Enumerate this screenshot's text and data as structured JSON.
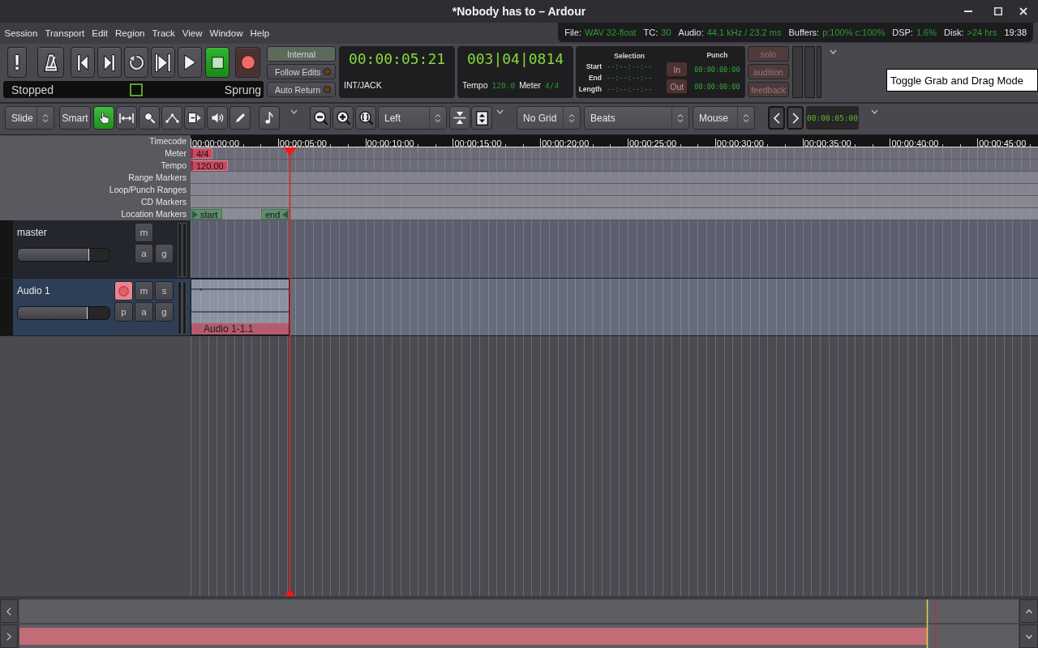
{
  "window": {
    "title": "*Nobody has to – Ardour"
  },
  "menu": [
    "Session",
    "Transport",
    "Edit",
    "Region",
    "Track",
    "View",
    "Window",
    "Help"
  ],
  "status_bar": {
    "items": [
      {
        "label": "File:",
        "value": "WAV 32-float"
      },
      {
        "label": "TC:",
        "value": "30"
      },
      {
        "label": "Audio:",
        "value": "44.1 kHz / 23.2 ms"
      },
      {
        "label": "Buffers:",
        "value": "p:100% c:100%"
      },
      {
        "label": "DSP:",
        "value": "1.6%"
      },
      {
        "label": "Disk:",
        "value": ">24 hrs"
      }
    ],
    "time": "19:38"
  },
  "transport": {
    "buttons": [
      {
        "kind": "error-log",
        "label": "!",
        "on": false
      },
      {
        "kind": "metronome",
        "on": false
      },
      {
        "kind": "to-start",
        "on": false
      },
      {
        "kind": "to-end",
        "on": false
      },
      {
        "kind": "loop",
        "on": false
      },
      {
        "kind": "play-range",
        "on": false
      },
      {
        "kind": "play",
        "on": false
      },
      {
        "kind": "stop",
        "on": true
      },
      {
        "kind": "record",
        "on": false
      }
    ],
    "status": {
      "state": "Stopped",
      "mode": "Sprung"
    },
    "sync_buttons": [
      {
        "kind": "sync",
        "label": "Internal",
        "on": false
      },
      {
        "kind": "toggle",
        "label": "Follow Edits",
        "on": false
      },
      {
        "kind": "toggle",
        "label": "Auto Return",
        "on": false
      }
    ]
  },
  "primary_clock": {
    "time": "00:00:05:21",
    "source": "INT/JACK"
  },
  "secondary_clock": {
    "time": "003|04|0814",
    "tempo_label": "Tempo",
    "tempo": "120.0",
    "meter_label": "Meter",
    "meter": "4/4"
  },
  "selection": {
    "title": "Selection",
    "rows": [
      {
        "label": "Start",
        "value": "--:--:--:--"
      },
      {
        "label": "End",
        "value": "--:--:--:--"
      },
      {
        "label": "Length",
        "value": "--:--:--:--"
      }
    ]
  },
  "punch": {
    "title": "Punch",
    "rows": [
      {
        "button": "In",
        "on": false,
        "value": "00:00:00:00"
      },
      {
        "button": "Out",
        "on": false,
        "value": "00:00:00:00"
      }
    ]
  },
  "monitor_buttons": [
    {
      "label": "solo",
      "on": false
    },
    {
      "label": "audition",
      "on": false
    },
    {
      "label": "feedback",
      "on": false
    }
  ],
  "tooltip": {
    "text": "Toggle Grab and Drag Mode"
  },
  "toolbar": {
    "edit_mode": "Slide",
    "smart": {
      "label": "Smart",
      "on": false
    },
    "tools": [
      {
        "kind": "grab",
        "selected": true
      },
      {
        "kind": "range",
        "selected": false
      },
      {
        "kind": "zoom",
        "selected": false
      },
      {
        "kind": "content",
        "selected": false
      },
      {
        "kind": "stretch",
        "selected": false
      },
      {
        "kind": "audition",
        "selected": false
      },
      {
        "kind": "draw",
        "selected": false
      }
    ],
    "zoom_focus": "Left",
    "grid_type": "No Grid",
    "grid_unit": "Beats",
    "edit_point": "Mouse",
    "nudge_clock": "00:00:05:00"
  },
  "rulers": [
    {
      "kind": "timecode",
      "label": "Timecode",
      "ticks": [
        "00:00:00:00",
        "00:00:05:00",
        "00:00:10:00",
        "00:00:15:00",
        "00:00:20:00",
        "00:00:25:00",
        "00:00:30:00",
        "00:00:35:00",
        "00:00:40:00",
        "00:00:45:00"
      ]
    },
    {
      "kind": "meter",
      "label": "Meter",
      "markers": [
        {
          "kind": "meter",
          "label": "4/4"
        }
      ]
    },
    {
      "kind": "tempo",
      "label": "Tempo",
      "markers": [
        {
          "kind": "tempo",
          "label": "120.00"
        }
      ]
    },
    {
      "kind": "range",
      "label": "Range Markers"
    },
    {
      "kind": "loop",
      "label": "Loop/Punch Ranges"
    },
    {
      "kind": "cd",
      "label": "CD Markers"
    },
    {
      "kind": "location",
      "label": "Location Markers",
      "markers": [
        {
          "kind": "start",
          "label": "start"
        },
        {
          "kind": "end",
          "label": "end"
        }
      ]
    }
  ],
  "tracks": [
    {
      "name": "master",
      "selected": false,
      "fader": {
        "level": 0.78
      },
      "buttons": [
        {
          "kind": "mute",
          "label": "m",
          "on": false
        },
        {
          "kind": "automation",
          "label": "a",
          "on": false
        },
        {
          "kind": "group",
          "label": "g",
          "on": false
        }
      ]
    },
    {
      "name": "Audio 1",
      "selected": true,
      "fader": {
        "level": 0.76
      },
      "buttons": [
        {
          "kind": "rec",
          "on": true
        },
        {
          "kind": "mute",
          "label": "m",
          "on": false
        },
        {
          "kind": "solo",
          "label": "s",
          "on": false
        },
        {
          "kind": "playlist",
          "label": "p",
          "on": false
        },
        {
          "kind": "automation",
          "label": "a",
          "on": false
        },
        {
          "kind": "group",
          "label": "g",
          "on": false
        }
      ],
      "regions": [
        {
          "name": "Audio 1-1.1"
        }
      ]
    }
  ]
}
